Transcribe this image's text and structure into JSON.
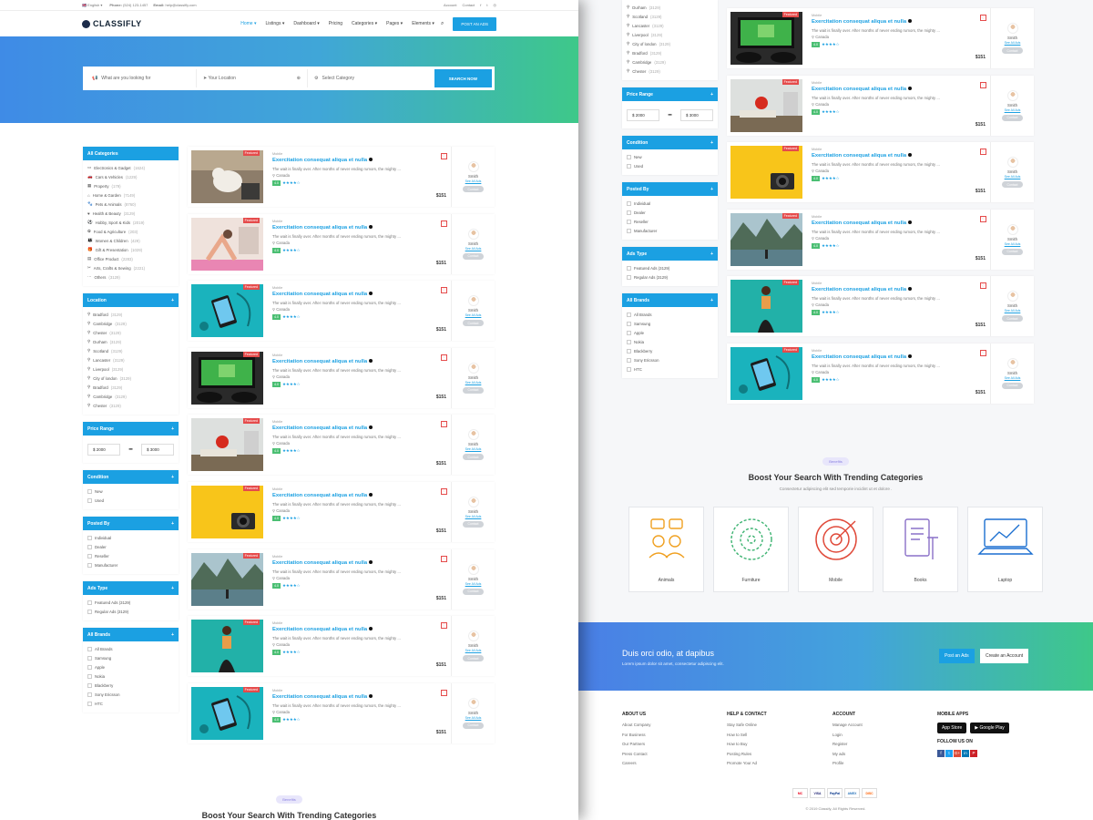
{
  "topbar": {
    "language": "English",
    "phone_label": "Phone:",
    "phone": "(524) 123-1457",
    "email_label": "Email:",
    "email": "help@classifly.com",
    "account": "Account",
    "contact": "Contact"
  },
  "brand": {
    "name": "CLASSIFLY"
  },
  "nav": {
    "items": [
      "Home ▾",
      "Listings ▾",
      "Dashboard ▾",
      "Pricing",
      "Categories ▾",
      "Pages ▾",
      "Elements ▾"
    ],
    "post_ad": "POST AN ADS"
  },
  "search": {
    "keyword_placeholder": "What are you looking for",
    "location_placeholder": "Your Location",
    "category": "Select Category",
    "button": "SEARCH NOW"
  },
  "sidebar": {
    "categories_title": "All Categories",
    "categories": [
      {
        "name": "Electronics & Gadget",
        "count": "(1624)"
      },
      {
        "name": "Cars & Vehicles",
        "count": "(1229)"
      },
      {
        "name": "Property",
        "count": "(179)"
      },
      {
        "name": "Home & Garden",
        "count": "(7149)"
      },
      {
        "name": "Pets & Animals",
        "count": "(8760)"
      },
      {
        "name": "Health & Beauty",
        "count": "(3129)"
      },
      {
        "name": "Hobby, Sport & Kids",
        "count": "(2019)"
      },
      {
        "name": "Food & Agriculture",
        "count": "(203)"
      },
      {
        "name": "Women & Children",
        "count": "(429)"
      },
      {
        "name": "Gift & Presentation",
        "count": "(1029)"
      },
      {
        "name": "Office Product",
        "count": "(2283)"
      },
      {
        "name": "Arts, Crafts & Sewing",
        "count": "(2221)"
      },
      {
        "name": "Others",
        "count": "(3129)"
      }
    ],
    "location_title": "Location",
    "locations": [
      {
        "name": "Bradford",
        "count": "(3129)"
      },
      {
        "name": "Cambridge",
        "count": "(3129)"
      },
      {
        "name": "Chester",
        "count": "(3129)"
      },
      {
        "name": "Durham",
        "count": "(3129)"
      },
      {
        "name": "Scotland",
        "count": "(3129)"
      },
      {
        "name": "Lancaster",
        "count": "(3129)"
      },
      {
        "name": "Liverpool",
        "count": "(3129)"
      },
      {
        "name": "City of london",
        "count": "(3129)"
      },
      {
        "name": "Bradford",
        "count": "(3129)"
      },
      {
        "name": "Cambridge",
        "count": "(3129)"
      },
      {
        "name": "Chester",
        "count": "(3129)"
      }
    ],
    "price_title": "Price Range",
    "price_min": "$ 2000",
    "price_max": "$ 3000",
    "condition_title": "Condition",
    "conditions": [
      "New",
      "Used"
    ],
    "posted_title": "Posted By",
    "posted_by": [
      "Individual",
      "Dealer",
      "Reseller",
      "Manufacturer"
    ],
    "adtype_title": "Ads Type",
    "ad_types": [
      "Featured Ads (3129)",
      "Regular Ads (3129)"
    ],
    "brands_title": "All Brands",
    "brands": [
      "All Brands",
      "Samsung",
      "Apple",
      "Nokia",
      "Blackberry",
      "Sony Ericsson",
      "HTC"
    ]
  },
  "listing": {
    "featured": "Featured",
    "category": "Mobile",
    "title": "Exercitation consequat aliqua et nulla",
    "description": "The wait is finally over. After months of never ending rumors, the mighty ...",
    "location": "Canada",
    "rating": "4.0",
    "stars": "★★★★☆",
    "price": "$151",
    "seller": "Smith",
    "see_all": "See All Ads",
    "contact": "Contact"
  },
  "left_cards": [
    {
      "img": "dog"
    },
    {
      "img": "yoga"
    },
    {
      "img": "phone"
    },
    {
      "img": "game"
    },
    {
      "img": "apple"
    },
    {
      "img": "camera"
    },
    {
      "img": "lake"
    },
    {
      "img": "dance"
    },
    {
      "img": "phone"
    }
  ],
  "right_cards": [
    {
      "img": "game"
    },
    {
      "img": "apple"
    },
    {
      "img": "camera"
    },
    {
      "img": "lake"
    },
    {
      "img": "dance"
    },
    {
      "img": "phone"
    }
  ],
  "benefits": {
    "pill": "Benefits",
    "title_pre": "Boost Your Search With ",
    "title_bold": "Trending Categories",
    "subtitle": "Consectetur adipiscing elit sed temporie incidint ut et dolore ."
  },
  "trending": [
    "Animals",
    "Furniture",
    "Mobile",
    "Books",
    "Laptop"
  ],
  "cta": {
    "title": "Duis orci odio, at dapibus",
    "subtitle": "Lorem ipsum dolor sit amet, consectetur adipiscing elit.",
    "post": "Post an Ads",
    "create": "Create an Account"
  },
  "footer": {
    "about_title": "ABOUT US",
    "about": [
      "About Company",
      "For Business",
      "Our Partners",
      "Press Contact",
      "Careers"
    ],
    "help_title": "HELP & CONTACT",
    "help": [
      "Stay Safe Online",
      "How to Sell",
      "How to Buy",
      "Posting Rules",
      "Promote Your Ad"
    ],
    "account_title": "ACCOUNT",
    "account": [
      "Manage Account",
      "Login",
      "Register",
      "My ads",
      "Profile"
    ],
    "apps_title": "MOBILE APPS",
    "app_store": "App Store",
    "google_play": "Google Play",
    "follow_title": "FOLLOW US ON",
    "social": [
      "f",
      "t",
      "G+",
      "in",
      "P"
    ],
    "payments": [
      "MC",
      "VISA",
      "PayPal",
      "AMEX",
      "DISC"
    ],
    "copyright": "© 2019 Classify, All Rights Reserved."
  },
  "colors": {
    "accent": "#1ba0e2",
    "featured": "#e54b4b",
    "rating": "#4bbf73"
  }
}
